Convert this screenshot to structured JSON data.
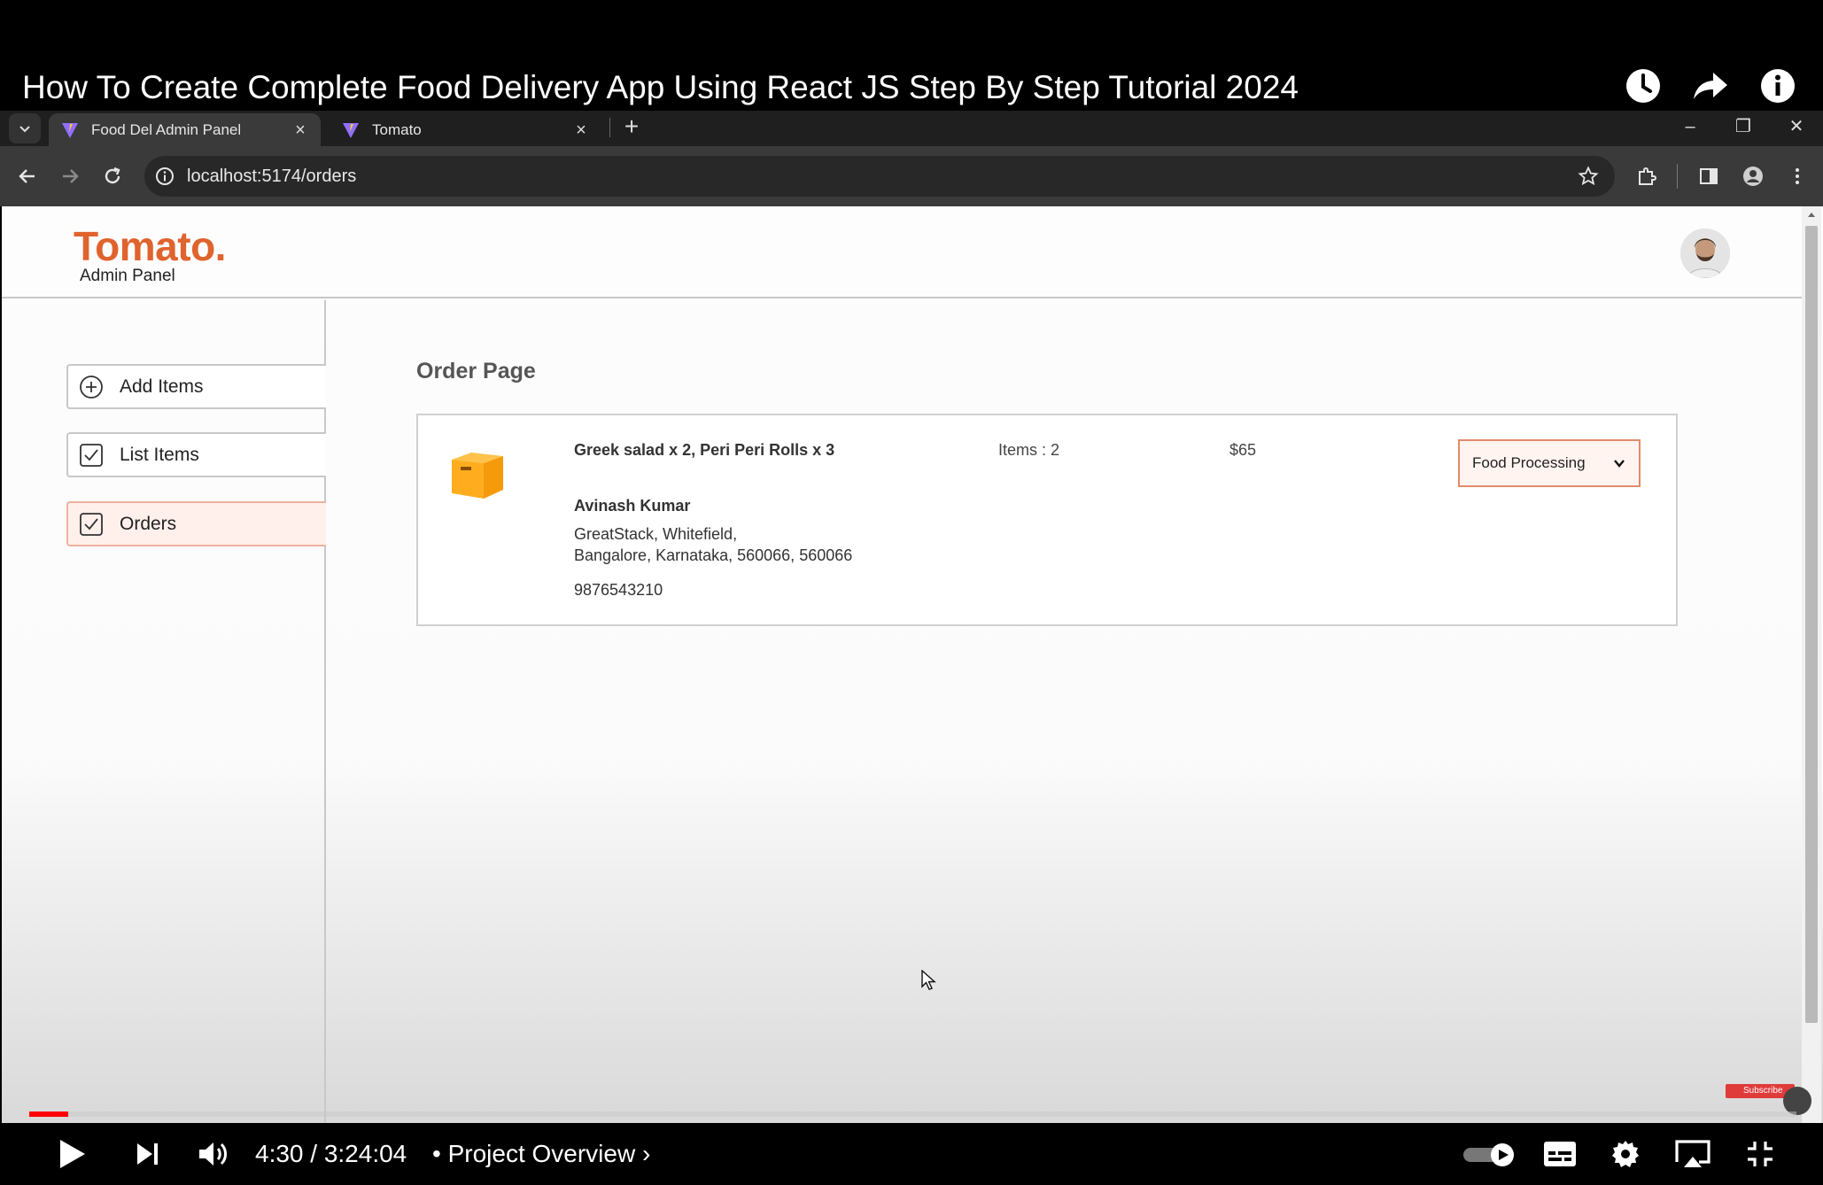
{
  "video": {
    "title": "How To Create Complete Food Delivery App Using React JS Step By Step Tutorial 2024",
    "time_current": "4:30",
    "time_total": "3:24:04",
    "time_display": "4:30 / 3:24:04",
    "chapter": "• Project Overview ›",
    "progress": 0.022,
    "subscribe_label": "Subscribe"
  },
  "browser": {
    "tabs": [
      {
        "label": "Food Del Admin Panel",
        "active": true
      },
      {
        "label": "Tomato",
        "active": false
      }
    ],
    "url": "localhost:5174/orders"
  },
  "app": {
    "logo": "Tomato.",
    "logo_subtitle": "Admin Panel",
    "brand_color": "#e0632d",
    "sidebar": {
      "items": [
        {
          "label": "Add Items",
          "icon": "plus-circle-icon",
          "active": false
        },
        {
          "label": "List Items",
          "icon": "checkbox-icon",
          "active": false
        },
        {
          "label": "Orders",
          "icon": "checkbox-icon",
          "active": true
        }
      ]
    },
    "page_title": "Order Page",
    "orders": [
      {
        "items": "Greek salad x 2, Peri Peri Rolls x 3",
        "count": "Items : 2",
        "amount": "$65",
        "customer": "Avinash Kumar",
        "address_line1": "GreatStack, Whitefield,",
        "address_line2": "Bangalore, Karnataka, 560066, 560066",
        "phone": "9876543210",
        "status": "Food Processing"
      }
    ]
  }
}
